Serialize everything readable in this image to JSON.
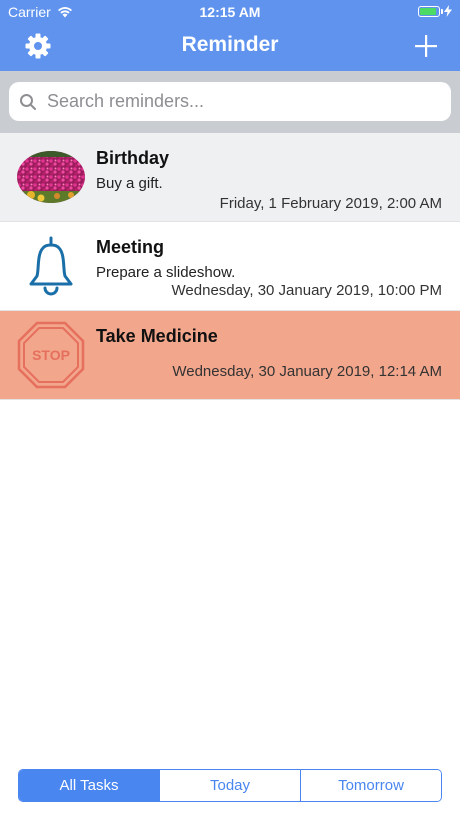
{
  "status_bar": {
    "carrier": "Carrier",
    "time": "12:15 AM",
    "battery_fill_fraction": 0.95,
    "battery_color": "#4cd964"
  },
  "nav": {
    "title": "Reminder",
    "left_icon": "gear-icon",
    "right_icon": "plus-icon",
    "background": "#5f93ee"
  },
  "search": {
    "placeholder": "Search reminders...",
    "value": ""
  },
  "reminders": [
    {
      "title": "Birthday",
      "note": "Buy a gift.",
      "date": "Friday, 1 February 2019, 2:00 AM",
      "icon": "flower-photo",
      "background": "#eef0f2"
    },
    {
      "title": "Meeting",
      "note": "Prepare a slideshow.",
      "date": "Wednesday, 30 January 2019, 10:00 PM",
      "icon": "bell-icon",
      "background": "#ffffff"
    },
    {
      "title": "Take Medicine",
      "note": "",
      "date": "Wednesday, 30 January 2019, 12:14 AM",
      "icon": "stop-sign-icon",
      "icon_text": "STOP",
      "background": "#f2a68c"
    }
  ],
  "filter_tabs": {
    "items": [
      "All Tasks",
      "Today",
      "Tomorrow"
    ],
    "selected": "All Tasks",
    "accent": "#4a86f0"
  }
}
